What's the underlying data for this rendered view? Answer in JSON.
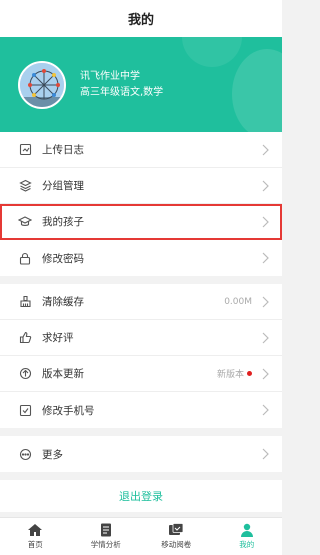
{
  "header": {
    "title": "我的"
  },
  "profile": {
    "school": "讯飞作业中学",
    "subjects": "高三年级语文,数学"
  },
  "menu_group1": [
    {
      "label": "上传日志",
      "icon": "upload-log-icon"
    },
    {
      "label": "分组管理",
      "icon": "layers-icon"
    },
    {
      "label": "我的孩子",
      "icon": "graduation-cap-icon",
      "highlighted": true
    },
    {
      "label": "修改密码",
      "icon": "lock-icon"
    }
  ],
  "menu_group2": [
    {
      "label": "清除缓存",
      "icon": "broom-icon",
      "value": "0.00M"
    },
    {
      "label": "求好评",
      "icon": "thumbs-up-icon"
    },
    {
      "label": "版本更新",
      "icon": "upgrade-icon",
      "value": "新版本"
    },
    {
      "label": "修改手机号",
      "icon": "phone-edit-icon"
    }
  ],
  "menu_group3": [
    {
      "label": "更多",
      "icon": "more-icon"
    }
  ],
  "logout": {
    "label": "退出登录"
  },
  "tabbar": [
    {
      "label": "首页",
      "icon": "home-icon"
    },
    {
      "label": "学情分析",
      "icon": "document-icon"
    },
    {
      "label": "移动阅卷",
      "icon": "grading-icon"
    },
    {
      "label": "我的",
      "icon": "user-icon",
      "active": true
    }
  ],
  "colors": {
    "accent": "#1fbf9d",
    "highlight": "#e53935",
    "badge": "#e02020"
  }
}
